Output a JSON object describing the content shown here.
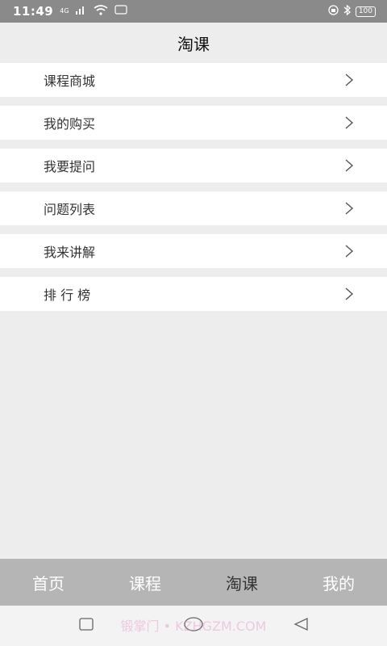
{
  "status": {
    "time": "11:49",
    "net_label": "4G",
    "battery": "100"
  },
  "title": "淘课",
  "menu": {
    "items": [
      {
        "label": "课程商城",
        "icon": "chevron-right-icon"
      },
      {
        "label": "我的购买",
        "icon": "chevron-right-icon"
      },
      {
        "label": "我要提问",
        "icon": "chevron-right-icon"
      },
      {
        "label": "问题列表",
        "icon": "chevron-right-icon"
      },
      {
        "label": "我来讲解",
        "icon": "chevron-right-icon"
      },
      {
        "label": "排 行 榜",
        "icon": "chevron-right-icon"
      }
    ]
  },
  "bottom_nav": {
    "tabs": [
      {
        "label": "首页"
      },
      {
        "label": "课程"
      },
      {
        "label": "淘课"
      },
      {
        "label": "我的"
      }
    ],
    "active": "淘课"
  },
  "watermark": "锻掌门 • KZHGZM.COM",
  "colors": {
    "background": "#ededed",
    "bottom_nav": "#b5b5b5",
    "status_bar": "#8a8a8a"
  }
}
